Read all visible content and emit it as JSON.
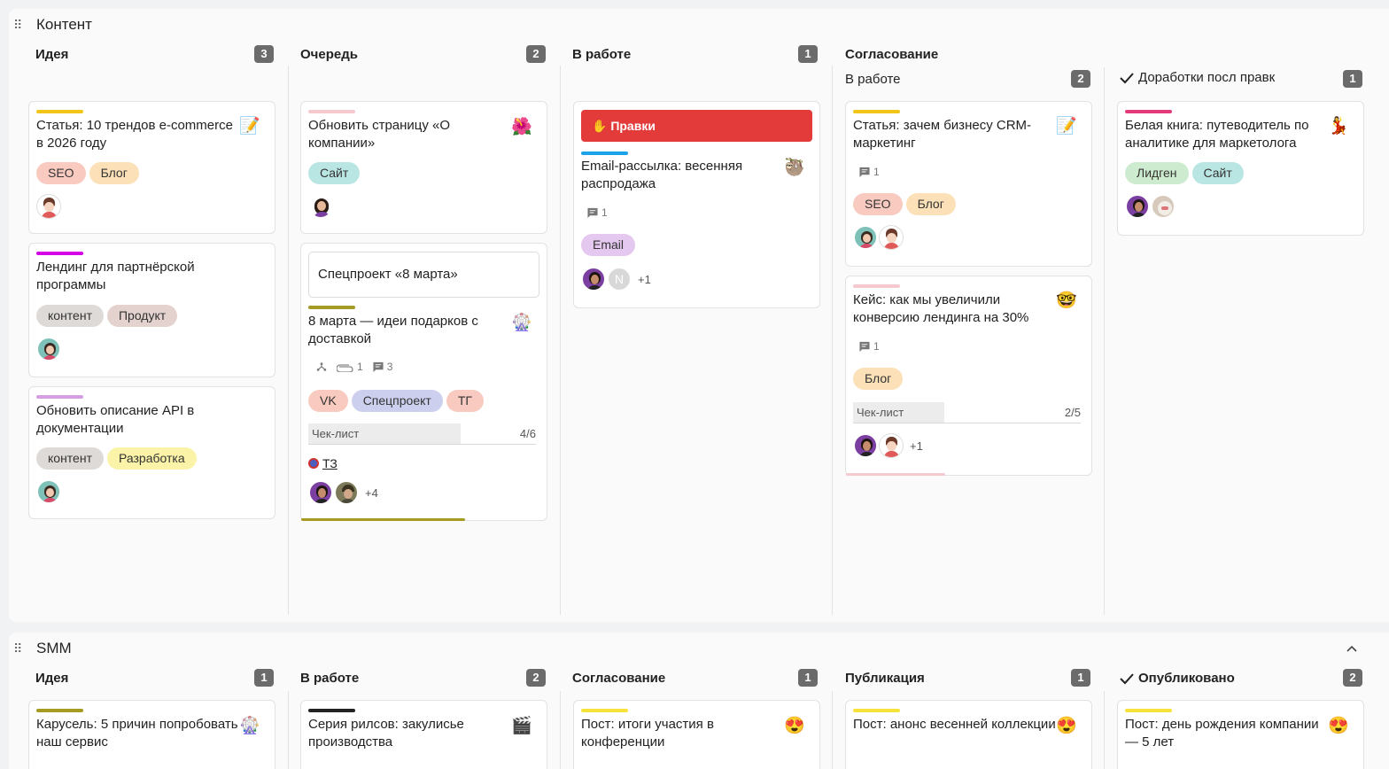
{
  "sections": [
    {
      "title": "Контент",
      "columns": [
        {
          "title": "Идея",
          "count": "3"
        },
        {
          "title": "Очередь",
          "count": "2"
        },
        {
          "title": "В работе",
          "count": "1"
        },
        {
          "title": "Согласование",
          "count": ""
        }
      ],
      "subcolumns": [
        {
          "title": "В работе",
          "count": "2"
        },
        {
          "title": "Доработки посл правк",
          "count": "1"
        }
      ]
    },
    {
      "title": "SMM",
      "columns": [
        {
          "title": "Идея",
          "count": "1"
        },
        {
          "title": "В работе",
          "count": "2"
        },
        {
          "title": "Согласование",
          "count": "1"
        },
        {
          "title": "Публикация",
          "count": "1"
        },
        {
          "title": "Опубликовано",
          "count": "2"
        }
      ]
    }
  ],
  "cards": {
    "c1": {
      "title": "Статья: 10 трендов e-commerce в 2026 году",
      "tags": [
        "SEO",
        "Блог"
      ],
      "stripe": "#f2c519",
      "emoji": "📝"
    },
    "c2": {
      "title": "Лендинг для партнёрской программы",
      "tags": [
        "контент",
        "Продукт"
      ],
      "stripe": "#d400e6"
    },
    "c3": {
      "title": "Обновить описание API в документации",
      "tags": [
        "контент",
        "Разработка"
      ],
      "stripe": "#d59ee0"
    },
    "c4": {
      "title": "Обновить страницу «О компании»",
      "tags": [
        "Сайт"
      ],
      "stripe": "#f6c9cf",
      "emoji": "🌺"
    },
    "c5": {
      "parent": "Спецпроект «8 марта»",
      "title": "8 марта — идеи подарков с доставкой",
      "tags": [
        "VK",
        "Спецпроект",
        "ТГ"
      ],
      "stripe": "#a59a22",
      "emoji": "🎡",
      "links": "1",
      "comments": "3",
      "checklist_label": "Чек-лист",
      "checklist": "4/6",
      "checklist_progress": 0.67,
      "doc_link": "ТЗ",
      "more": "+4"
    },
    "c6": {
      "banner": "✋ Правки",
      "title": "Email-рассылка: весенняя распродажа",
      "tags": [
        "Email"
      ],
      "stripe": "#1aa3e8",
      "emoji": "🦥",
      "comments": "1",
      "avatar_letter": "N",
      "more": "+1"
    },
    "c7": {
      "title": "Статья: зачем бизнесу CRM-маркетинг",
      "tags": [
        "SEO",
        "Блог"
      ],
      "stripe": "#f2c519",
      "emoji": "📝",
      "comments": "1"
    },
    "c8": {
      "title": "Кейс: как мы увеличили конверсию лендинга на 30%",
      "tags": [
        "Блог"
      ],
      "stripe": "#f6c9cf",
      "emoji": "🤓",
      "comments": "1",
      "checklist_label": "Чек-лист",
      "checklist": "2/5",
      "checklist_progress": 0.4,
      "more": "+1"
    },
    "c9": {
      "title": "Белая книга: путеводитель по аналитике для маркетолога",
      "tags": [
        "Лидген",
        "Сайт"
      ],
      "stripe": "#e33a7a",
      "emoji": "💃"
    },
    "s1": {
      "title": "Карусель: 5 причин попробовать наш сервис",
      "stripe": "#a59a22",
      "emoji": "🎡"
    },
    "s2": {
      "title": "Серия рилсов: закулисье производства",
      "stripe": "#222222",
      "emoji": "🎬"
    },
    "s3": {
      "title": "Пост: итоги участия в конференции",
      "stripe": "#f7e23b",
      "emoji": "😍"
    },
    "s4": {
      "title": "Пост: анонс весенней коллекции",
      "stripe": "#f7e23b",
      "emoji": "😍"
    },
    "s5": {
      "title": "Пост: день рождения компании — 5 лет",
      "stripe": "#f7e23b",
      "emoji": "😍"
    }
  },
  "tag_colors": {
    "SEO": "#f9cbc0",
    "Блог": "#fbe0b8",
    "контент": "#dedad7",
    "Продукт": "#e3d2ce",
    "Разработка": "#fbf3a8",
    "Сайт": "#b9e5e2",
    "VK": "#f9cbc0",
    "Спецпроект": "#cccfed",
    "ТГ": "#f9cbc0",
    "Email": "#e4c8ef",
    "Лидген": "#cdeccf"
  }
}
